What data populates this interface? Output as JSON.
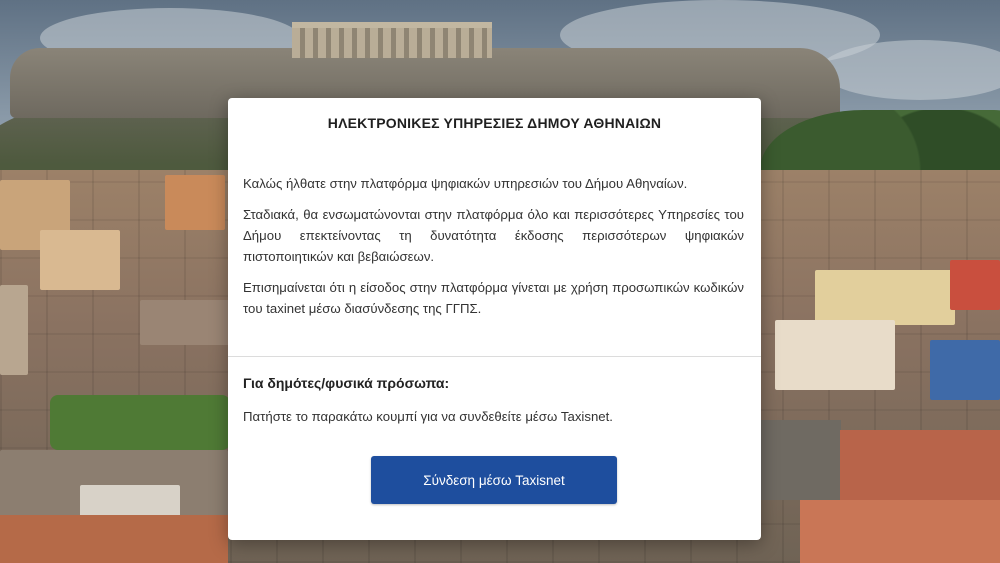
{
  "modal": {
    "title": "ΗΛΕΚΤΡΟΝΙΚΕΣ ΥΠΗΡΕΣΙΕΣ ΔΗΜΟΥ ΑΘΗΝΑΙΩΝ",
    "paragraphs": [
      "Καλώς ήλθατε στην πλατφόρμα ψηφιακών υπηρεσιών του Δήμου Αθηναίων.",
      "Σταδιακά, θα ενσωματώνονται στην πλατφόρμα όλο και περισσότερες Υπηρεσίες του Δήμου επεκτείνοντας τη δυνατότητα έκδοσης περισσότερων ψηφιακών πιστοποιητικών και βεβαιώσεων.",
      "Επισημαίνεται ότι η είσοδος στην πλατφόρμα γίνεται με χρήση προσωπικών κωδικών του taxinet μέσω διασύνδεσης της ΓΓΠΣ."
    ],
    "section_heading": "Για δημότες/φυσικά πρόσωπα:",
    "section_text": "Πατήστε το παρακάτω κουμπί για να συνδεθείτε μέσω Taxisnet.",
    "login_button_label": "Σύνδεση μέσω Taxisnet"
  },
  "colors": {
    "button_background": "#1e4e9e",
    "button_text": "#ffffff",
    "card_background": "#ffffff"
  },
  "background": {
    "icon": "athens-acropolis-photo"
  }
}
